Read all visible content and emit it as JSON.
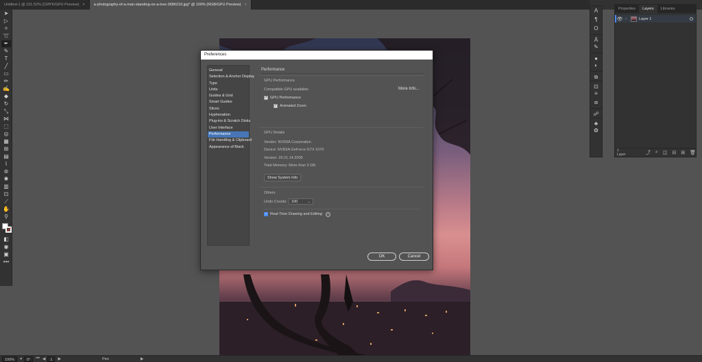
{
  "tabs": [
    {
      "label": "Untitled-1 @ 101.52% (CMYK/GPU Preview)",
      "close": "×"
    },
    {
      "label": "a-photography-of-a-man-standing-on-a-tree-3686219.jpg* @ 100% (RGB/GPU Preview)",
      "close": "×"
    }
  ],
  "tools": [
    "selection-tool",
    "direct-selection-tool",
    "magic-wand-tool",
    "lasso-tool",
    "pen-tool",
    "curvature-tool",
    "type-tool",
    "line-tool",
    "rectangle-tool",
    "paintbrush-tool",
    "shaper-tool",
    "eraser-tool",
    "rotate-tool",
    "scale-tool",
    "width-tool",
    "free-transform-tool",
    "shape-builder-tool",
    "perspective-grid-tool",
    "mesh-tool",
    "gradient-tool",
    "eyedropper-tool",
    "blend-tool",
    "symbol-sprayer-tool",
    "column-graph-tool",
    "artboard-tool",
    "slice-tool",
    "hand-tool",
    "zoom-tool"
  ],
  "panel": {
    "tabs": [
      "Properties",
      "Layers",
      "Libraries"
    ],
    "layer_name": "Layer 1",
    "layer_count": "1 Layer"
  },
  "dialog": {
    "title": "Preferences",
    "categories": [
      "General",
      "Selection & Anchor Display",
      "Type",
      "Units",
      "Guides & Grid",
      "Smart Guides",
      "Slices",
      "Hyphenation",
      "Plug-ins & Scratch Disks",
      "User Interface",
      "Performance",
      "File Handling & Clipboard",
      "Appearance of Black"
    ],
    "selected_category": "Performance",
    "heading": "Performance",
    "gpu_performance": {
      "heading": "GPU Performance",
      "status": "Compatible GPU available.",
      "more_info": "More Info...",
      "gpu_checkbox": "GPU Performance",
      "animated_zoom": "Animated Zoom"
    },
    "gpu_details": {
      "heading": "GPU Details",
      "vendor": "Vendor: NVIDIA Corporation",
      "device": "Device: NVIDIA GeForce GTX 1070",
      "version": "Version: 26.21.14.3200",
      "memory": "Total Memory:  More than 3 GB.",
      "show_system_info": "Show System Info"
    },
    "others": {
      "heading": "Others",
      "undo_label": "Undo Counts:",
      "undo_value": "100",
      "realtime": "Real-Time Drawing and Editing"
    },
    "ok": "OK",
    "cancel": "Cancel"
  },
  "status": {
    "zoom": "100%",
    "rotation": "0°",
    "artboard": "1",
    "tool": "Pen"
  }
}
